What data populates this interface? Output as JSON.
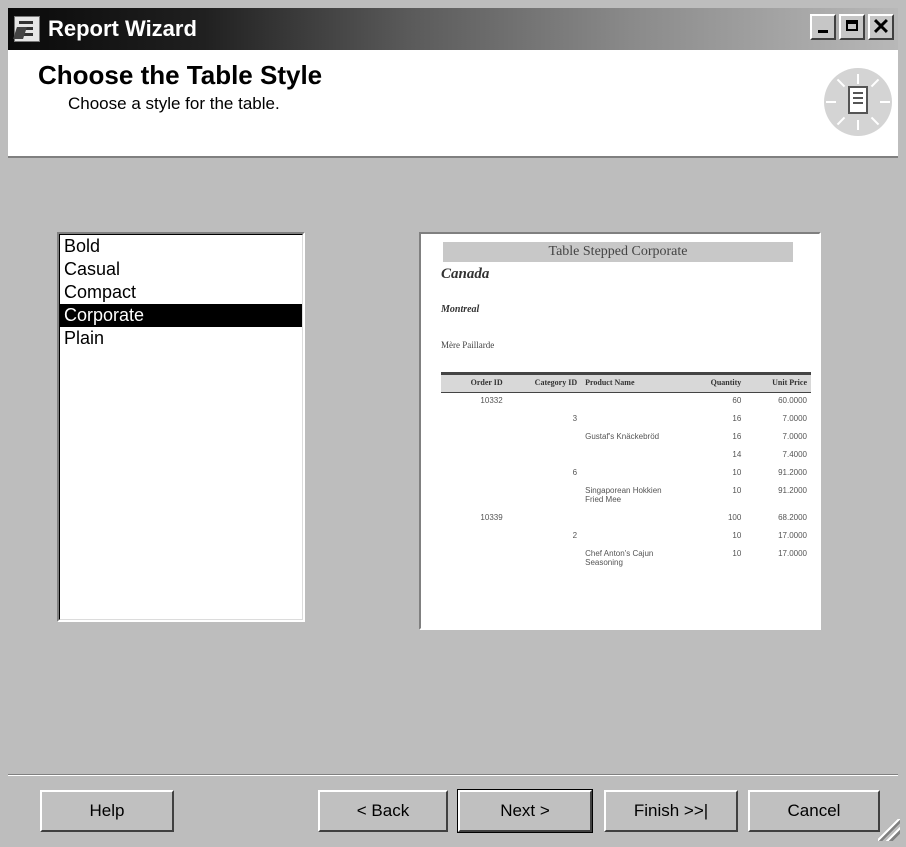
{
  "window": {
    "title": "Report Wizard"
  },
  "title_bar_buttons": {
    "minimize": "_",
    "maximize": "□",
    "close": "✕"
  },
  "header": {
    "title": "Choose the Table Style",
    "subtitle": "Choose a style for the table.",
    "icon": "report-wizard-emblem-icon"
  },
  "style_list": {
    "items": [
      {
        "label": "Bold",
        "selected": false
      },
      {
        "label": "Casual",
        "selected": false
      },
      {
        "label": "Compact",
        "selected": false
      },
      {
        "label": "Corporate",
        "selected": true
      },
      {
        "label": "Plain",
        "selected": false
      }
    ]
  },
  "preview": {
    "title": "Table Stepped Corporate",
    "country": "Canada",
    "city": "Montreal",
    "company": "Mère Paillarde",
    "columns": [
      "Order ID",
      "Category ID",
      "Product Name",
      "Quantity",
      "Unit Price"
    ],
    "rows": [
      [
        "10332",
        "",
        "",
        "60",
        "60.0000"
      ],
      [
        "",
        "3",
        "",
        "16",
        "7.0000"
      ],
      [
        "",
        "",
        "Gustaf's Knäckebröd",
        "16",
        "7.0000"
      ],
      [
        "",
        "",
        "",
        "14",
        "7.4000"
      ],
      [
        "",
        "6",
        "",
        "10",
        "91.2000"
      ],
      [
        "",
        "",
        "Singaporean Hokkien Fried Mee",
        "10",
        "91.2000"
      ],
      [
        "10339",
        "",
        "",
        "100",
        "68.2000"
      ],
      [
        "",
        "2",
        "",
        "10",
        "17.0000"
      ],
      [
        "",
        "",
        "Chef Anton's Cajun Seasoning",
        "10",
        "17.0000"
      ]
    ]
  },
  "buttons": {
    "help": "Help",
    "back": "< Back",
    "next": "Next >",
    "finish": "Finish >>|",
    "cancel": "Cancel"
  }
}
